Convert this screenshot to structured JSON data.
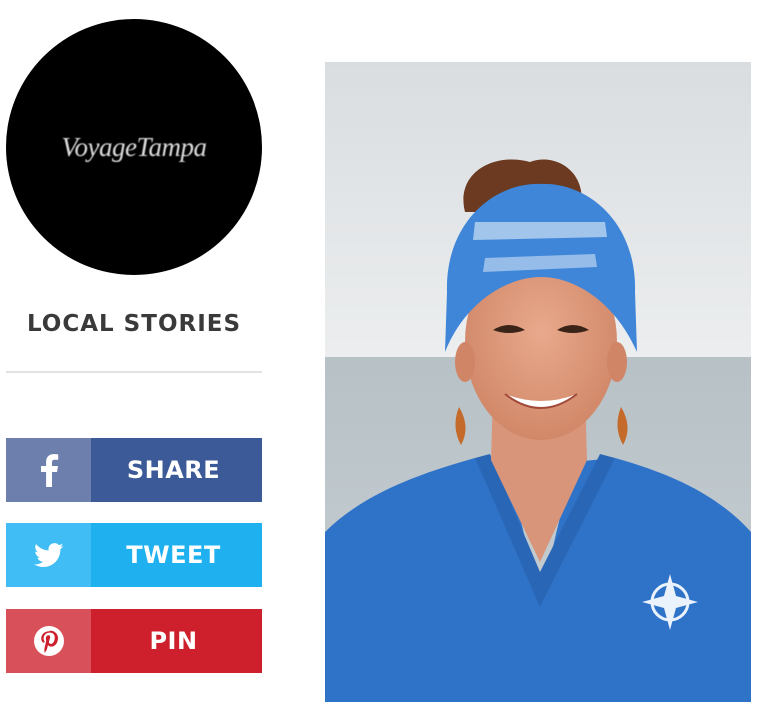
{
  "logo": {
    "text": "VoyageTampa"
  },
  "sidebar": {
    "heading": "LOCAL STORIES"
  },
  "share": {
    "facebook": {
      "label": "SHARE",
      "icon": "facebook-icon",
      "color": "#3d5a98"
    },
    "twitter": {
      "label": "TWEET",
      "icon": "twitter-icon",
      "color": "#1fb0f0"
    },
    "pinterest": {
      "label": "PIN",
      "icon": "pinterest-icon",
      "color": "#cd202c"
    }
  },
  "photo": {
    "description_icon": "portrait-photo"
  }
}
